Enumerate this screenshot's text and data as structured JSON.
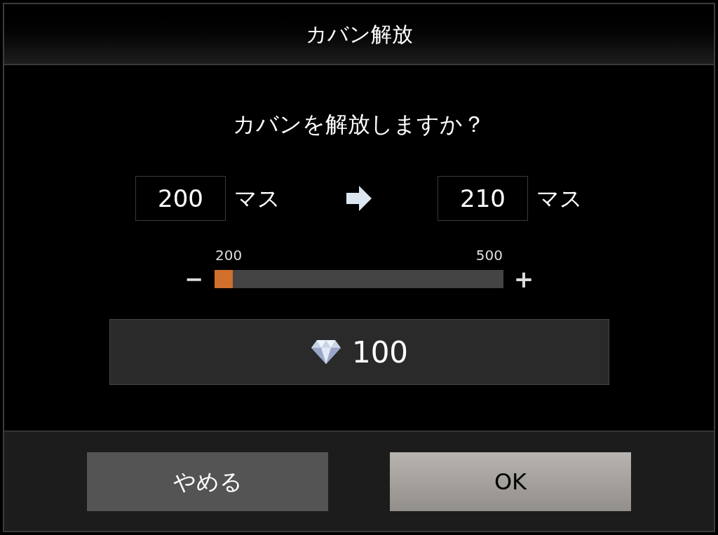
{
  "dialog": {
    "title": "カバン解放"
  },
  "question": "カバンを解放しますか？",
  "capacity": {
    "from": {
      "value": "200",
      "unit": "マス"
    },
    "to": {
      "value": "210",
      "unit": "マス"
    }
  },
  "slider": {
    "min_label": "200",
    "max_label": "500",
    "level": 0,
    "minus": "−",
    "plus": "+"
  },
  "cost": {
    "amount": "100"
  },
  "buttons": [
    {
      "label": "やめる",
      "kind": "secondary"
    },
    {
      "label": "OK",
      "kind": "primary"
    }
  ]
}
